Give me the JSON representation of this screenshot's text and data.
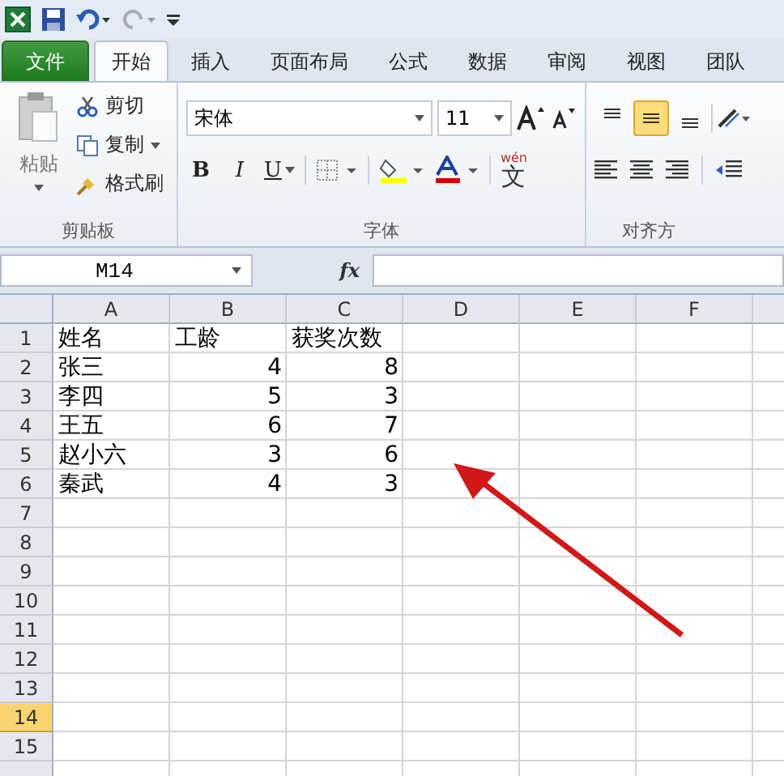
{
  "tabs": [
    {
      "label": "文件",
      "kind": "file",
      "selected": false
    },
    {
      "label": "开始",
      "kind": "tab",
      "selected": true
    },
    {
      "label": "插入",
      "kind": "tab",
      "selected": false
    },
    {
      "label": "页面布局",
      "kind": "tab",
      "selected": false
    },
    {
      "label": "公式",
      "kind": "tab",
      "selected": false
    },
    {
      "label": "数据",
      "kind": "tab",
      "selected": false
    },
    {
      "label": "审阅",
      "kind": "tab",
      "selected": false
    },
    {
      "label": "视图",
      "kind": "tab",
      "selected": false
    },
    {
      "label": "团队",
      "kind": "tab",
      "selected": false
    }
  ],
  "clipboard": {
    "paste": "粘贴",
    "cut": "剪切",
    "copy": "复制",
    "format_painter": "格式刷",
    "group_label": "剪贴板"
  },
  "font": {
    "name": "宋体",
    "size": "11",
    "bold": "B",
    "italic": "I",
    "underline": "U",
    "phonetic_top": "wén",
    "phonetic_char": "文",
    "group_label": "字体"
  },
  "alignment": {
    "vertical": [
      {
        "selected": false
      },
      {
        "selected": true
      },
      {
        "selected": false
      }
    ],
    "group_label": "对齐方"
  },
  "formula_bar": {
    "name_box": "M14",
    "fx": "fx"
  },
  "sheet": {
    "columns": [
      "A",
      "B",
      "C",
      "D",
      "E",
      "F"
    ],
    "rows": [
      {
        "number": "1",
        "selected": false,
        "cells": [
          {
            "text": "姓名",
            "kind": "text"
          },
          {
            "text": "工龄",
            "kind": "text"
          },
          {
            "text": "获奖次数",
            "kind": "text"
          }
        ]
      },
      {
        "number": "2",
        "selected": false,
        "cells": [
          {
            "text": "张三",
            "kind": "text"
          },
          {
            "text": "4",
            "kind": "number"
          },
          {
            "text": "8",
            "kind": "number"
          }
        ]
      },
      {
        "number": "3",
        "selected": false,
        "cells": [
          {
            "text": "李四",
            "kind": "text"
          },
          {
            "text": "5",
            "kind": "number"
          },
          {
            "text": "3",
            "kind": "number"
          }
        ]
      },
      {
        "number": "4",
        "selected": false,
        "cells": [
          {
            "text": "王五",
            "kind": "text"
          },
          {
            "text": "6",
            "kind": "number"
          },
          {
            "text": "7",
            "kind": "number"
          }
        ]
      },
      {
        "number": "5",
        "selected": false,
        "cells": [
          {
            "text": "赵小六",
            "kind": "text"
          },
          {
            "text": "3",
            "kind": "number"
          },
          {
            "text": "6",
            "kind": "number"
          }
        ]
      },
      {
        "number": "6",
        "selected": false,
        "cells": [
          {
            "text": "秦武",
            "kind": "text"
          },
          {
            "text": "4",
            "kind": "number"
          },
          {
            "text": "3",
            "kind": "number"
          }
        ]
      },
      {
        "number": "7",
        "selected": false,
        "cells": []
      },
      {
        "number": "8",
        "selected": false,
        "cells": []
      },
      {
        "number": "9",
        "selected": false,
        "cells": []
      },
      {
        "number": "10",
        "selected": false,
        "cells": []
      },
      {
        "number": "11",
        "selected": false,
        "cells": []
      },
      {
        "number": "12",
        "selected": false,
        "cells": []
      },
      {
        "number": "13",
        "selected": false,
        "cells": []
      },
      {
        "number": "14",
        "selected": true,
        "cells": []
      },
      {
        "number": "15",
        "selected": false,
        "cells": []
      }
    ]
  }
}
